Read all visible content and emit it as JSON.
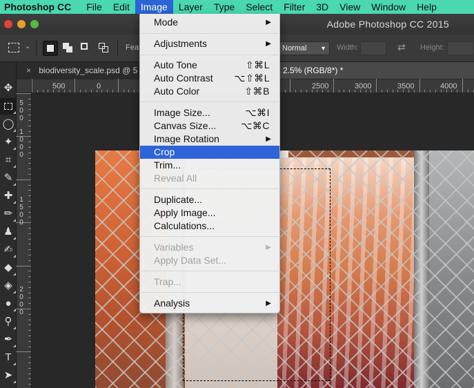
{
  "menubar": {
    "app_name": "Photoshop CC",
    "items": [
      {
        "label": "File"
      },
      {
        "label": "Edit"
      },
      {
        "label": "Image"
      },
      {
        "label": "Layer"
      },
      {
        "label": "Type"
      },
      {
        "label": "Select"
      },
      {
        "label": "Filter"
      },
      {
        "label": "3D"
      },
      {
        "label": "View"
      },
      {
        "label": "Window"
      },
      {
        "label": "Help"
      }
    ],
    "active_item": "Image",
    "bar_color": "#4ad8b0",
    "active_color": "#2a64d6"
  },
  "window": {
    "title": "Adobe Photoshop CC 2015"
  },
  "options_bar": {
    "feather_label": "Feat",
    "style_value": "Normal",
    "width_label": "Width:",
    "height_label": "Height:"
  },
  "tabs": {
    "inactive_label": "biodiversity_scale.psd @ 5",
    "active_label": "2.5% (RGB/8*) *",
    "close_glyph": "×"
  },
  "ruler": {
    "h_labels": [
      "500",
      "0",
      "2500",
      "3000",
      "3500",
      "4000"
    ],
    "v_labels": [
      "5",
      "0",
      "0",
      "1",
      "0",
      "0",
      "0",
      "1",
      "5",
      "0",
      "0",
      "2",
      "0",
      "0",
      "0"
    ]
  },
  "image_menu": {
    "highlight_color": "#2e64d8",
    "items": {
      "mode": {
        "label": "Mode",
        "arrow": "▶"
      },
      "adjustments": {
        "label": "Adjustments",
        "arrow": "▶"
      },
      "auto_tone": {
        "label": "Auto Tone",
        "shortcut": "⇧⌘L"
      },
      "auto_contrast": {
        "label": "Auto Contrast",
        "shortcut": "⌥⇧⌘L"
      },
      "auto_color": {
        "label": "Auto Color",
        "shortcut": "⇧⌘B"
      },
      "image_size": {
        "label": "Image Size...",
        "shortcut": "⌥⌘I"
      },
      "canvas_size": {
        "label": "Canvas Size...",
        "shortcut": "⌥⌘C"
      },
      "image_rotation": {
        "label": "Image Rotation",
        "arrow": "▶"
      },
      "crop": {
        "label": "Crop"
      },
      "trim": {
        "label": "Trim..."
      },
      "reveal_all": {
        "label": "Reveal All"
      },
      "duplicate": {
        "label": "Duplicate..."
      },
      "apply_image": {
        "label": "Apply Image..."
      },
      "calculations": {
        "label": "Calculations..."
      },
      "variables": {
        "label": "Variables",
        "arrow": "▶"
      },
      "apply_data_set": {
        "label": "Apply Data Set..."
      },
      "trap": {
        "label": "Trap..."
      },
      "analysis": {
        "label": "Analysis",
        "arrow": "▶"
      }
    }
  },
  "tools": {
    "icons": [
      "move-icon",
      "rect-marquee-icon",
      "lasso-icon",
      "magic-wand-icon",
      "crop-icon",
      "eyedropper-icon",
      "healing-brush-icon",
      "brush-icon",
      "clone-stamp-icon",
      "history-brush-icon",
      "eraser-icon",
      "paint-bucket-icon",
      "blur-icon",
      "dodge-icon",
      "pen-icon",
      "type-icon",
      "path-selection-icon"
    ]
  }
}
